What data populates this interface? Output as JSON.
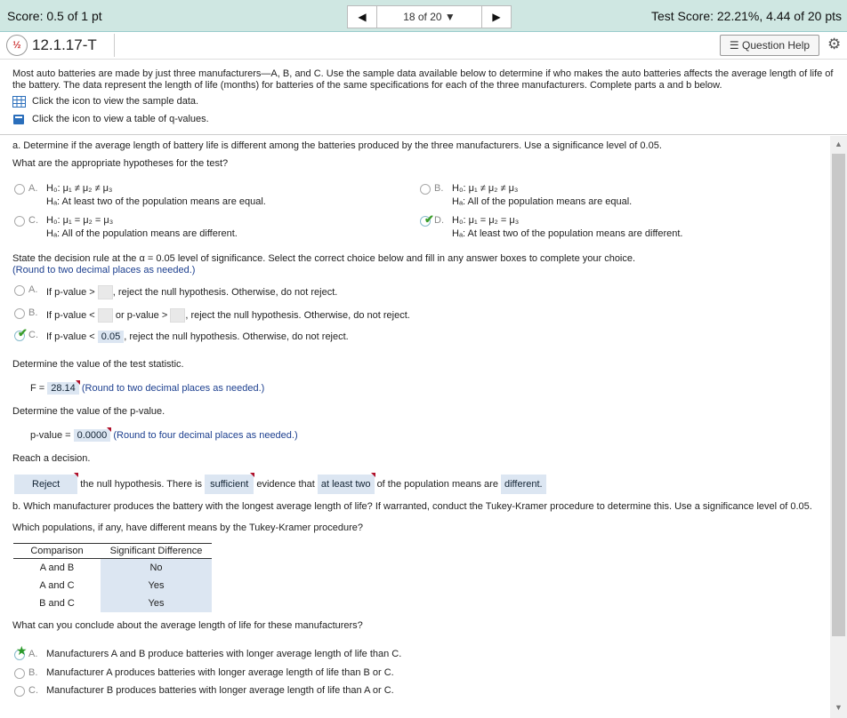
{
  "header": {
    "score": "Score: 0.5 of 1 pt",
    "nav_position": "18 of 20",
    "test_score": "Test Score: 22.21%, 4.44 of 20 pts"
  },
  "question": {
    "id": "12.1.17-T",
    "help_label": "Question Help",
    "status_icon_text": "½"
  },
  "intro": {
    "text": "Most auto batteries are made by just three manufacturers—A, B, and C. Use the sample data available below to determine if who makes the auto batteries affects the average length of life of the battery. The data represent the length of life (months) for batteries of the same specifications for each of the three manufacturers. Complete parts a and b below.",
    "link_data": "Click the icon to view the sample data.",
    "link_q": "Click the icon to view a table of q-values."
  },
  "part_a": {
    "prompt": "a. Determine if the average length of battery life is different among the batteries produced by the three manufacturers. Use a significance level of 0.05.",
    "hyp_question": "What are the appropriate hypotheses for the test?",
    "options": [
      {
        "letter": "A.",
        "h0": "H₀: μ₁ ≠ μ₂ ≠ μ₃",
        "ha": "Hₐ: At least two of the population means are equal."
      },
      {
        "letter": "B.",
        "h0": "H₀: μ₁ ≠ μ₂ ≠ μ₃",
        "ha": "Hₐ: All of the population means are equal."
      },
      {
        "letter": "C.",
        "h0": "H₀: μ₁ = μ₂ = μ₃",
        "ha": "Hₐ: All of the population means are different."
      },
      {
        "letter": "D.",
        "h0": "H₀: μ₁ = μ₂ = μ₃",
        "ha": "Hₐ: At least two of the population means are different."
      }
    ],
    "decision_rule_prompt": "State the decision rule at the α = 0.05 level of significance. Select the correct choice below and fill in any answer boxes to complete your choice.",
    "round2": "(Round to two decimal places as needed.)",
    "rules": [
      {
        "letter": "A.",
        "pre": "If p-value >",
        "post": ", reject the null hypothesis. Otherwise, do not reject."
      },
      {
        "letter": "B.",
        "pre": "If p-value <",
        "mid": "or p-value >",
        "post": ", reject the null hypothesis. Otherwise, do not reject."
      },
      {
        "letter": "C.",
        "pre": "If p-value <",
        "value": "0.05",
        "post": ", reject the null hypothesis. Otherwise, do not reject."
      }
    ],
    "stat_prompt": "Determine the value of the test statistic.",
    "f_label": "F =",
    "f_value": "28.14",
    "f_round": "(Round to two decimal places as needed.)",
    "p_prompt": "Determine the value of the p-value.",
    "p_label": "p-value =",
    "p_value": "0.0000",
    "p_round": "(Round to four decimal places as needed.)",
    "decision_prompt": "Reach a decision.",
    "decision": {
      "choice1": "Reject",
      "text1": "the null hypothesis. There is",
      "choice2": "sufficient",
      "text2": "evidence that",
      "choice3": "at least two",
      "text3": "of the population means are",
      "choice4": "different."
    }
  },
  "part_b": {
    "prompt": "b. Which manufacturer produces the battery with the longest average length of life? If warranted, conduct the Tukey-Kramer procedure to determine this. Use a significance level of 0.05.",
    "tukey_question": "Which populations, if any, have different means by the Tukey-Kramer procedure?",
    "table_headers": [
      "Comparison",
      "Significant Difference"
    ],
    "table_rows": [
      [
        "A and B",
        "No"
      ],
      [
        "A and C",
        "Yes"
      ],
      [
        "B and C",
        "Yes"
      ]
    ],
    "conclude_question": "What can you conclude about the average length of life for these manufacturers?",
    "options": [
      {
        "letter": "A.",
        "text": "Manufacturers A and B produce batteries with longer average length of life than C."
      },
      {
        "letter": "B.",
        "text": "Manufacturer A produces batteries with longer average length of life than B or C."
      },
      {
        "letter": "C.",
        "text": "Manufacturer B produces batteries with longer average length of life than A or C."
      }
    ]
  },
  "colors": {
    "topbar": "#cfe7e2",
    "answer_box": "#dce6f2",
    "correct_check": "#3a9d2a",
    "flag": "#b0102a"
  }
}
